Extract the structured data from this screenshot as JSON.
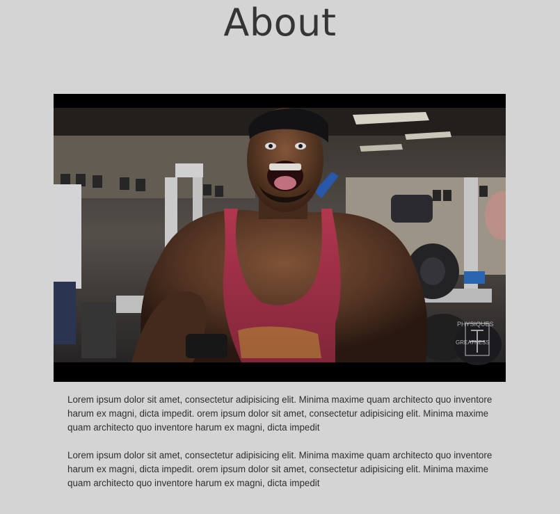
{
  "page": {
    "title": "About"
  },
  "video": {
    "watermark_line1": "PHYSIQUES",
    "watermark_line2": "GREATNESS"
  },
  "content": {
    "paragraphs": [
      "Lorem ipsum dolor sit amet, consectetur adipisicing elit. Minima maxime quam architecto quo inventore harum ex magni, dicta impedit. orem ipsum dolor sit amet, consectetur adipisicing elit. Minima maxime quam architecto quo inventore harum ex magni, dicta impedit",
      "Lorem ipsum dolor sit amet, consectetur adipisicing elit. Minima maxime quam architecto quo inventore harum ex magni, dicta impedit. orem ipsum dolor sit amet, consectetur adipisicing elit. Minima maxime quam architecto quo inventore harum ex magni, dicta impedit"
    ]
  },
  "colors": {
    "background": "#d4d4d4",
    "title_text": "#353535",
    "body_text": "#2e2e2e",
    "video_letterbox": "#000000",
    "tank_top": "#b3374f"
  }
}
